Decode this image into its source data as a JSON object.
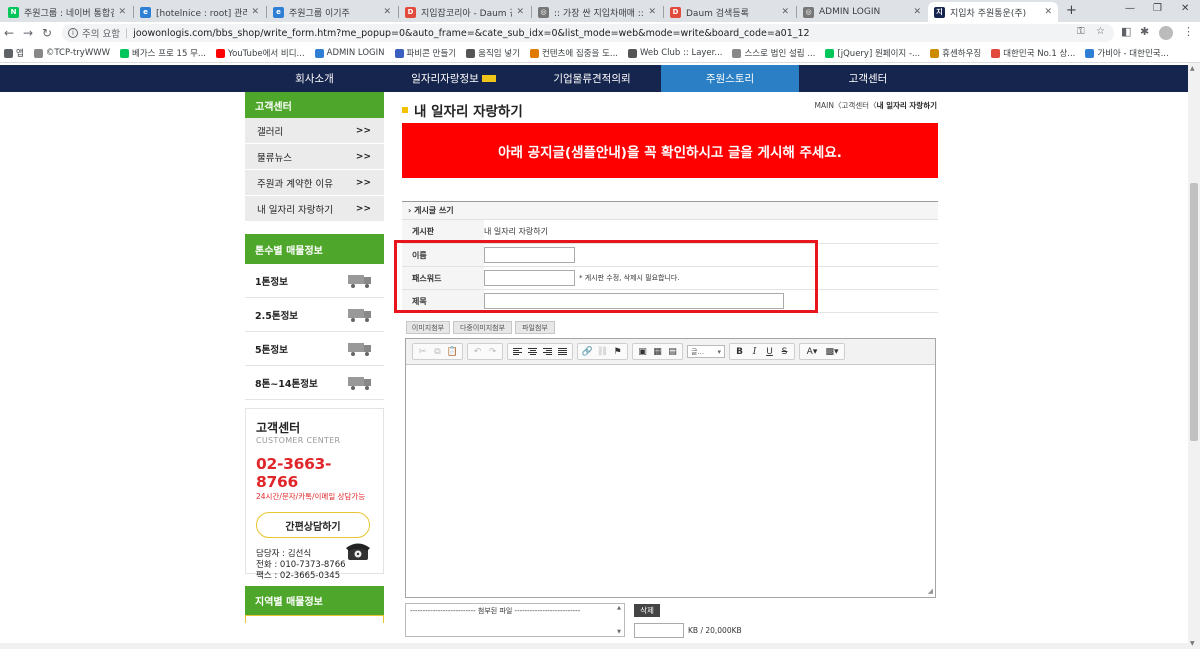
{
  "browser": {
    "tabs": [
      {
        "title": "주원그룹 : 네이버 통합검색",
        "fav": "N",
        "color": "#03c75a"
      },
      {
        "title": "[hotelnice : root] 관리자 페",
        "fav": "e",
        "color": "#2f7fd4"
      },
      {
        "title": "주원그룹 이기주",
        "fav": "e",
        "color": "#2f7fd4"
      },
      {
        "title": "지입잡코리아 - Daum 검색",
        "fav": "D",
        "color": "#e24a3c"
      },
      {
        "title": ":: 가장 싼 지입차매매 :: 지입",
        "fav": "◎",
        "color": "#777777"
      },
      {
        "title": "Daum 검색등록",
        "fav": "D",
        "color": "#e24a3c"
      },
      {
        "title": "ADMIN LOGIN",
        "fav": "◎",
        "color": "#777777"
      },
      {
        "title": "지입차 주원통운(주)",
        "fav": "지",
        "color": "#16254d"
      }
    ],
    "new_tab": "+",
    "security_label": "주의 요함",
    "url": "joowonlogis.com/bbs_shop/write_form.htm?me_popup=0&auto_frame=&cate_sub_idx=0&list_mode=web&mode=write&board_code=a01_12",
    "bookmarks": [
      {
        "label": "앱",
        "color": "#5f6368"
      },
      {
        "label": "©TCP-tryWWW",
        "color": "#888888"
      },
      {
        "label": "베가스 프로 15 무...",
        "color": "#03c75a"
      },
      {
        "label": "YouTube에서 비디...",
        "color": "#ff0000"
      },
      {
        "label": "ADMIN LOGIN",
        "color": "#2f7fd4"
      },
      {
        "label": "파비콘 만들기",
        "color": "#3b5fc0"
      },
      {
        "label": "움직임 넣기",
        "color": "#555555"
      },
      {
        "label": "컨텐츠에 집중을 도...",
        "color": "#e07b00"
      },
      {
        "label": "Web Club :: Layer...",
        "color": "#555555"
      },
      {
        "label": "스스로 법인 설립 ...",
        "color": "#888888"
      },
      {
        "label": "[jQuery] 원페이지 -...",
        "color": "#03c75a"
      },
      {
        "label": "휴센하우징",
        "color": "#cc8a00"
      },
      {
        "label": "대한민국 No.1 상...",
        "color": "#e24a3c"
      },
      {
        "label": "가비아 - 대한민국...",
        "color": "#2f7fd4"
      }
    ]
  },
  "nav": {
    "items": [
      "회사소개",
      "일자리자랑정보",
      "기업물류견적의뢰",
      "주원스토리",
      "고객센터"
    ]
  },
  "sidebar": {
    "head": "고객센터",
    "items": [
      "갤러리",
      "물류뉴스",
      "주원과 계약한 이유",
      "내 일자리 자랑하기"
    ],
    "arrow": ">>",
    "ton_head": "톤수별 매물정보",
    "tons": [
      "1톤정보",
      "2.5톤정보",
      "5톤정보",
      "8톤~14톤정보"
    ],
    "cc": {
      "title": "고객센터",
      "eng": "CUSTOMER CENTER",
      "phone": "02-3663-8766",
      "hours": "24시간/문자/카톡/이메일 상담가능",
      "button": "간편상담하기",
      "manager": "담당자 : 김선식",
      "tel": "전화 : 010-7373-8766",
      "fax": "팩스 : 02-3665-0345"
    },
    "region_head": "지역별 매물정보"
  },
  "main": {
    "title": "내 일자리 자랑하기",
    "crumb_prefix": "MAIN〈고객센터〈",
    "crumb_current": "내 일자리 자랑하기",
    "notice": "아래 공지글(샘플안내)을 꼭 확인하시고 글을 게시해 주세요.",
    "form_title": "› 게시글 쓰기",
    "board_label": "게시판",
    "board_value": "내 일자리 자랑하기",
    "name_label": "이름",
    "password_label": "패스워드",
    "password_hint": "* 게시판 수정, 삭제시 필요합니다.",
    "subject_label": "제목",
    "tabs": [
      "이미지첨부",
      "다중이미지첨부",
      "파일첨부"
    ],
    "font_select": "글...",
    "attach_label": "-------------------------- 첨부된 파일 --------------------------",
    "delete_button": "삭제",
    "size_text": "KB / 20,000KB"
  }
}
